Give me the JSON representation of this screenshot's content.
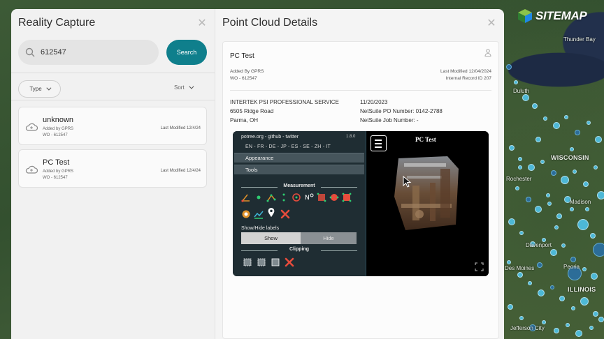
{
  "map": {
    "labels": {
      "thunder_bay": "Thunder Bay",
      "duluth": "Duluth",
      "wisconsin": "WISCONSIN",
      "rochester": "Rochester",
      "madison": "Madison",
      "davenport": "Davenport",
      "peoria": "Peoria",
      "illinois": "ILLINOIS",
      "des_moines": "Des Moines",
      "jefferson_city": "Jefferson City"
    }
  },
  "logo": {
    "text": "SITEMAP"
  },
  "reality_capture": {
    "title": "Reality Capture",
    "search": {
      "value": "612547",
      "placeholder": "Search",
      "button_label": "Search"
    },
    "filters": {
      "type_label": "Type",
      "sort_label": "Sort"
    },
    "items": [
      {
        "name": "unknown",
        "added_by": "Added by GPRS",
        "wo": "WO - 612547",
        "last_modified": "Last Modified 12/4/24"
      },
      {
        "name": "PC Test",
        "added_by": "Added by GPRS",
        "wo": "WO - 612547",
        "last_modified": "Last Modified 12/4/24"
      }
    ]
  },
  "point_cloud_details": {
    "title": "Point Cloud Details",
    "name": "PC Test",
    "added_by": "Added By GPRS",
    "wo": "WO - 612547",
    "last_modified": "Last Modified 12/04/2024",
    "internal_record": "Internal Record ID 207",
    "company": "INTERTEK PSI PROFESSIONAL SERVICE",
    "address1": "6505 Ridge Road",
    "address2": "Parma, OH",
    "date": "11/20/2023",
    "po_number": "NetSuite PO Number: 0142-2788",
    "job_number": "NetSuite Job Number: -"
  },
  "viewer": {
    "header": "potree.org - github - twitter",
    "version": "1.8.0",
    "languages": "EN - FR - DE - JP - ES - SE - ZH - IT",
    "sections": {
      "appearance": "Appearance",
      "tools": "Tools"
    },
    "measurement_label": "Measurement",
    "show_hide_label": "Show/Hide labels",
    "show": "Show",
    "hide": "Hide",
    "clipping_label": "Clipping",
    "render_title": "PC Test"
  },
  "colors": {
    "accent": "#0f7f8c",
    "map_dot": "#4fc3e8",
    "viewer_panel": "#1f2d33"
  }
}
